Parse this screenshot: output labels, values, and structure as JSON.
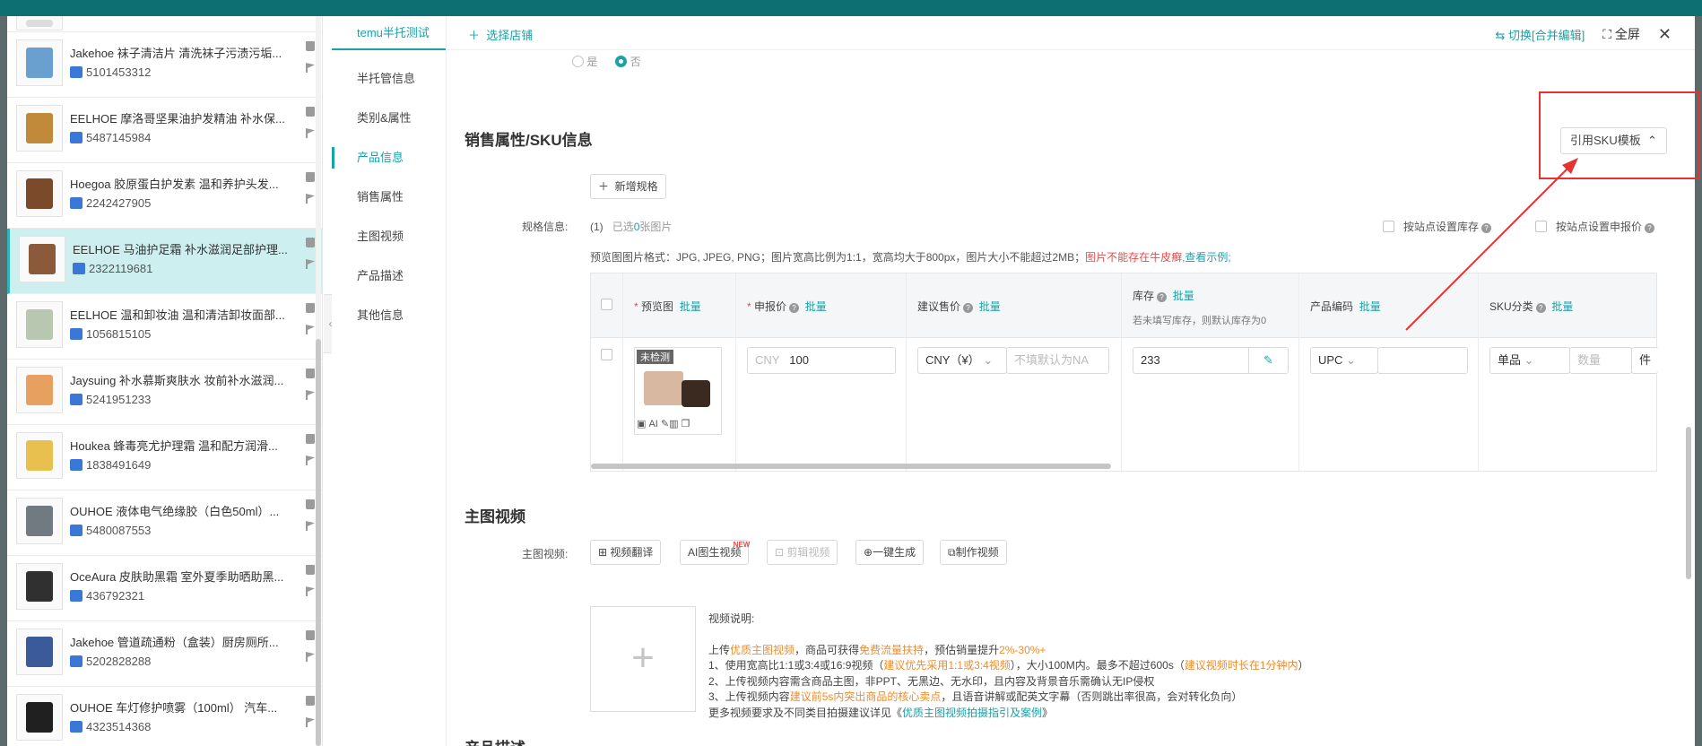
{
  "header": {
    "active_tab": "temu半托测试",
    "add_shop": "选择店铺",
    "switch_label": "切换[合并编辑]",
    "fullscreen_label": "全屏"
  },
  "products": [
    {
      "title": "",
      "id": "",
      "color": "#dddddd"
    },
    {
      "title": "Jakehoe 袜子清洁片 清洗袜子污渍污垢...",
      "id": "5101453312",
      "color": "#6aa0d0"
    },
    {
      "title": "EELHOE 摩洛哥坚果油护发精油 补水保...",
      "id": "5487145984",
      "color": "#c08a3a"
    },
    {
      "title": "Hoegoa 胶原蛋白护发素 温和养护头发...",
      "id": "2242427905",
      "color": "#7a4a2a"
    },
    {
      "title": "EELHOE 马油护足霜 补水滋润足部护理...",
      "id": "2322119681",
      "color": "#8a5a3a"
    },
    {
      "title": "EELHOE 温和卸妆油 温和清洁卸妆面部...",
      "id": "1056815105",
      "color": "#b8c8b0"
    },
    {
      "title": "Jaysuing 补水慕斯爽肤水 妆前补水滋润...",
      "id": "5241951233",
      "color": "#e8a060"
    },
    {
      "title": "Houkea 蜂毒亮尤护理霜 温和配方润滑...",
      "id": "1838491649",
      "color": "#e8c050"
    },
    {
      "title": "OUHOE 液体电气绝缘胶（白色50ml）...",
      "id": "5480087553",
      "color": "#707a80"
    },
    {
      "title": "OceAura 皮肤助黑霜 室外夏季助晒助黑...",
      "id": "436792321",
      "color": "#303030"
    },
    {
      "title": "Jakehoe 管道疏通粉（盒装）厨房厕所...",
      "id": "5202828288",
      "color": "#3a5a9a"
    },
    {
      "title": "OUHOE 车灯修护喷雾（100ml） 汽车...",
      "id": "4323514368",
      "color": "#202020"
    }
  ],
  "nav": {
    "items": [
      "半托管信息",
      "类别&属性",
      "产品信息",
      "销售属性",
      "主图视频",
      "产品描述",
      "其他信息"
    ]
  },
  "radio": {
    "yes": "是",
    "no": "否"
  },
  "sku": {
    "title": "销售属性/SKU信息",
    "template_button": "引用SKU模板",
    "add_spec": "新增规格",
    "spec_label": "规格信息:",
    "count": "(1)",
    "selected_prefix": "已选",
    "selected_count": "0",
    "selected_suffix": "张图片",
    "stock_by_site": "按站点设置库存",
    "price_by_site": "按站点设置申报价",
    "tip_format": "预览图图片格式：JPG, JPEG, PNG；图片宽高比例为1:1，宽高均大于800px，图片大小不能超过2MB；",
    "tip_warn": "图片不能存在牛皮癣,",
    "tip_link": "查看示例;",
    "batch": "批量",
    "col_preview": "预览图",
    "col_declared": "申报价",
    "col_suggested": "建议售价",
    "col_stock": "库存",
    "stock_note": "若未填写库存，则默认库存为0",
    "col_code": "产品编码",
    "col_category": "SKU分类",
    "unchecked_tag": "未检测",
    "ai_tag": "AI",
    "currency_cny": "CNY",
    "declared_value": "100",
    "currency_select": "CNY（¥）",
    "suggested_placeholder": "不填默认为NA",
    "stock_value": "233",
    "code_select": "UPC",
    "category_select": "单品",
    "qty_placeholder": "数量",
    "unit": "件"
  },
  "video": {
    "title": "主图视频",
    "label": "主图视频:",
    "buttons": [
      "视频翻译",
      "AI图生视频",
      "剪辑视频",
      "一键生成",
      "制作视频"
    ],
    "new_badge": "NEW",
    "desc_title": "视频说明:",
    "l1a": "上传",
    "l1b": "优质主图视频",
    "l1c": "，商品可获得",
    "l1d": "免费流量扶持",
    "l1e": "，预估销量提升",
    "l1f": "2%-30%+",
    "l2a": "1、使用宽高比1:1或3:4或16:9视频（",
    "l2b": "建议优先采用1:1或3:4视频",
    "l2c": "），大小100M内。最多不超过600s（",
    "l2d": "建议视频时长在1分钟内",
    "l2e": "）",
    "l3": "2、上传视频内容需含商品主图，非PPT、无黑边、无水印，且内容及背景音乐需确认无IP侵权",
    "l4a": "3、上传视频内容",
    "l4b": "建议前5s内突出商品的核心卖点",
    "l4c": "，且语音讲解或配英文字幕（否则跳出率很高，会对转化负向）",
    "l5a": "更多视频要求及不同类目拍摄建议详见《",
    "l5b": "优质主图视频拍摄指引及案例",
    "l5c": "》"
  },
  "desc_title_partial": "产品描述"
}
